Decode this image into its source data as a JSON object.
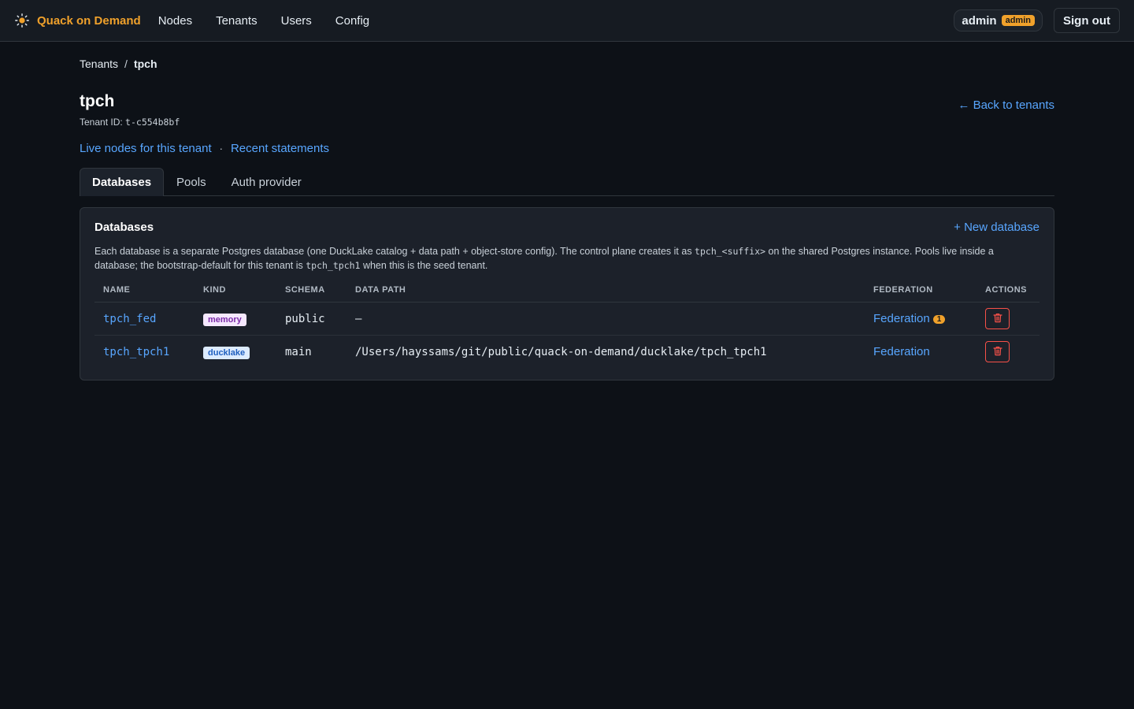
{
  "brand": {
    "name": "Quack on Demand",
    "icon": "sun-icon",
    "color": "#f0a12b"
  },
  "nav": {
    "items": [
      {
        "label": "Nodes"
      },
      {
        "label": "Tenants"
      },
      {
        "label": "Users"
      },
      {
        "label": "Config"
      }
    ]
  },
  "user": {
    "name": "admin",
    "role_badge": "admin"
  },
  "signout": {
    "label": "Sign out"
  },
  "breadcrumb": {
    "parent": "Tenants",
    "separator": "/",
    "current": "tpch"
  },
  "page": {
    "title": "tpch",
    "tenant_id_label": "Tenant ID:",
    "tenant_id": "t-c554b8bf",
    "back_link": "← Back to tenants"
  },
  "quick_links": {
    "live_nodes": "Live nodes for this tenant",
    "separator": "·",
    "recent_statements": "Recent statements"
  },
  "tabs": [
    {
      "label": "Databases",
      "active": true
    },
    {
      "label": "Pools",
      "active": false
    },
    {
      "label": "Auth provider",
      "active": false
    }
  ],
  "panel": {
    "title": "Databases",
    "new_link": "+ New database",
    "desc_part1": "Each database is a separate Postgres database (one DuckLake catalog + data path + object-store config). The control plane creates it as ",
    "desc_code1": "tpch_<suffix>",
    "desc_part2": " on the shared Postgres instance. Pools live inside a database; the bootstrap-default for this tenant is ",
    "desc_code2": "tpch_tpch1",
    "desc_part3": " when this is the seed tenant."
  },
  "table": {
    "headers": {
      "name": "NAME",
      "kind": "KIND",
      "schema": "SCHEMA",
      "data_path": "DATA PATH",
      "federation": "FEDERATION",
      "actions": "ACTIONS"
    },
    "rows": [
      {
        "name": "tpch_fed",
        "kind": "memory",
        "schema": "public",
        "data_path": "–",
        "federation": "Federation",
        "federation_count": "1"
      },
      {
        "name": "tpch_tpch1",
        "kind": "ducklake",
        "schema": "main",
        "data_path": "/Users/hayssams/git/public/quack-on-demand/ducklake/tpch_tpch1",
        "federation": "Federation"
      }
    ]
  },
  "colors": {
    "accent": "#58a6ff",
    "brand": "#f0a12b",
    "danger": "#f85149",
    "background": "#0d1117"
  }
}
